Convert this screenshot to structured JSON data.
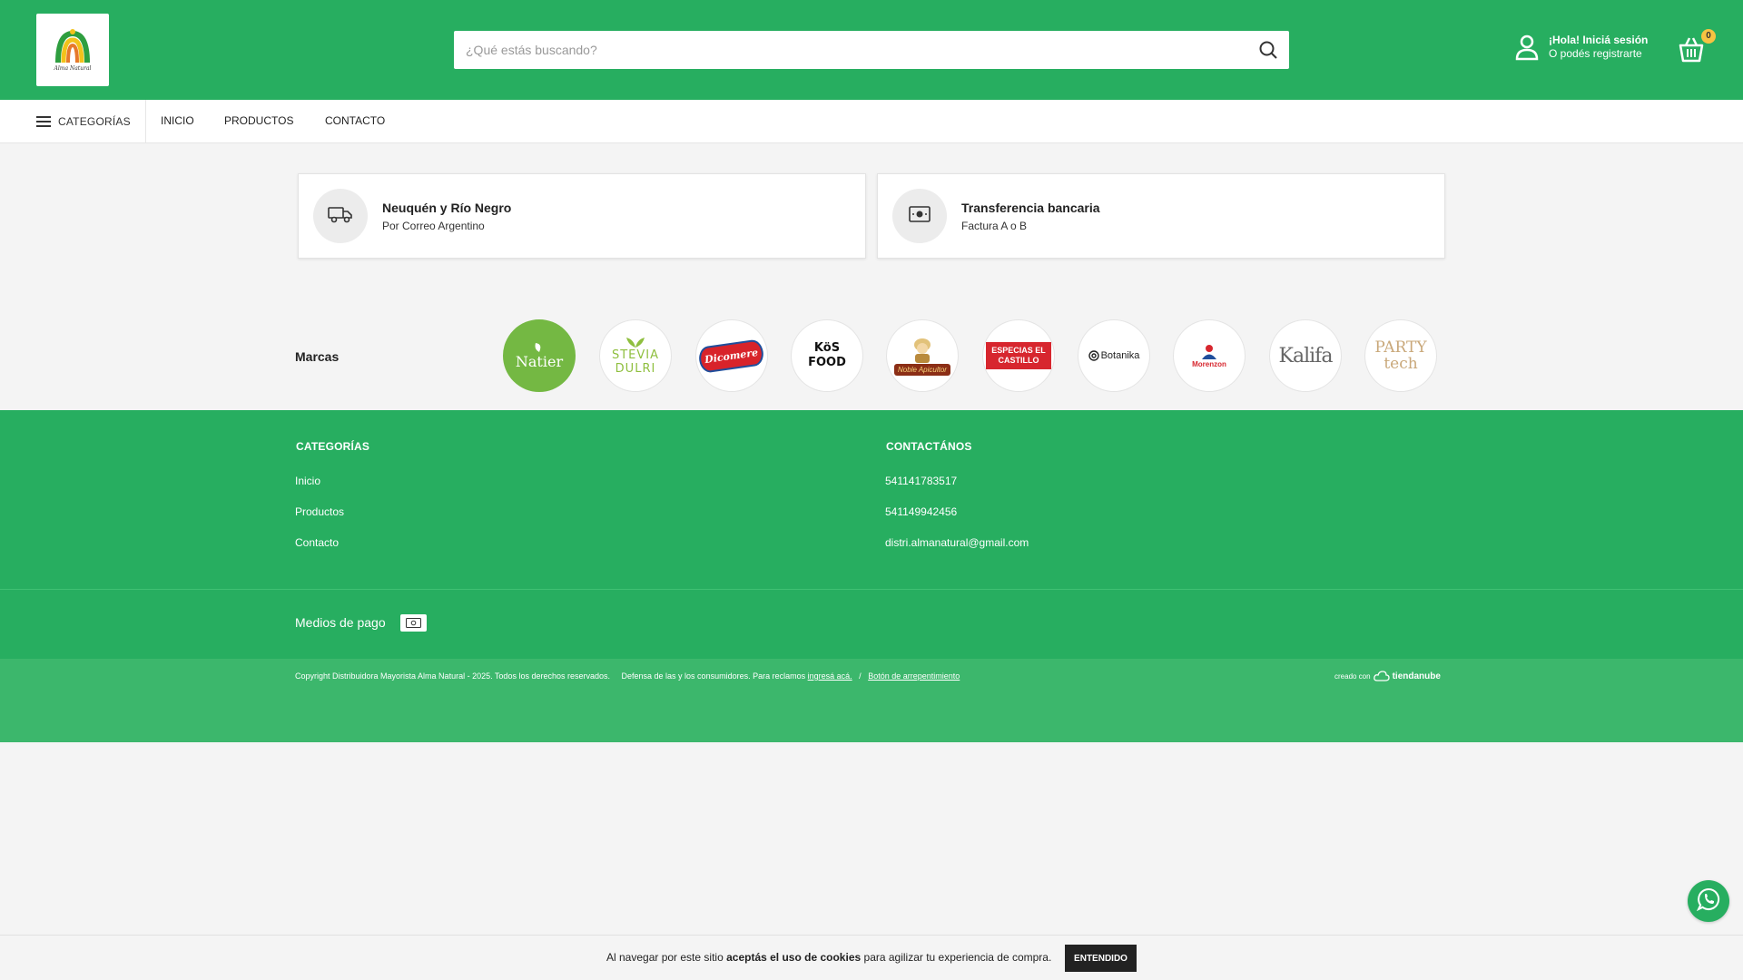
{
  "colors": {
    "brand_green": "#27ae60",
    "copyright_green": "#3cb76c",
    "cart_badge": "#f6c342"
  },
  "header": {
    "logo_text": "Alma Natural",
    "search_placeholder": "¿Qué estás buscando?",
    "search_icon": "search-icon",
    "account_title": "¡Hola! Iniciá sesión",
    "account_sub": "O podés registrarte",
    "cart_count": "0"
  },
  "nav": {
    "categories": "CATEGORÍAS",
    "links": [
      "INICIO",
      "PRODUCTOS",
      "CONTACTO"
    ]
  },
  "info_cards": [
    {
      "icon": "truck-icon",
      "title": "Neuquén y Río Negro",
      "sub": "Por Correo Argentino"
    },
    {
      "icon": "money-icon",
      "title": "Transferencia bancaria",
      "sub": "Factura A o B"
    }
  ],
  "brands": {
    "label": "Marcas",
    "items": [
      "Natier",
      "STEVIA DULRI",
      "Dicomere",
      "KöS FOOD",
      "Noble Apicultor",
      "ESPECIAS EL CASTILLO",
      "Botanika",
      "Morenzon",
      "Kalifa",
      "PARTY tech"
    ]
  },
  "footer": {
    "categories_heading": "CATEGORÍAS",
    "categories_links": [
      "Inicio",
      "Productos",
      "Contacto"
    ],
    "contact_heading": "CONTACTÁNOS",
    "contact_items": [
      "541141783517",
      "541149942456",
      "distri.almanatural@gmail.com"
    ],
    "payments_label": "Medios de pago",
    "copyright": "Copyright Distribuidora Mayorista Alma Natural - 2025. Todos los derechos reservados.",
    "defensa_prefix": "Defensa de las y los consumidores. Para reclamos",
    "defensa_link": "ingresá acá.",
    "separator": "/",
    "arrepentimiento": "Botón de arrepentimiento",
    "creado_con": "creado con",
    "tiendanube": "tiendanube"
  },
  "cookie": {
    "text_before": "Al navegar por este sitio",
    "text_bold": "aceptás el uso de cookies",
    "text_after": "para agilizar tu experiencia de compra.",
    "button": "ENTENDIDO"
  }
}
